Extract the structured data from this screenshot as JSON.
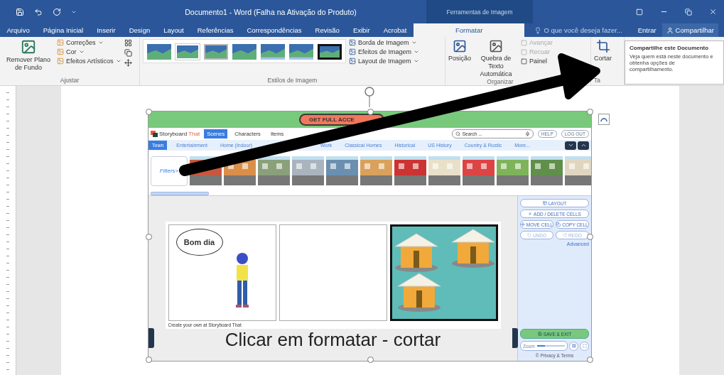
{
  "title_bar": {
    "title": "Documento1 - Word (Falha na Ativação do Produto)",
    "context_label": "Ferramentas de Imagem"
  },
  "tabs": [
    {
      "label": "Arquivo",
      "selected": false
    },
    {
      "label": "Página Inicial",
      "selected": false
    },
    {
      "label": "Inserir",
      "selected": false
    },
    {
      "label": "Design",
      "selected": false
    },
    {
      "label": "Layout",
      "selected": false
    },
    {
      "label": "Referências",
      "selected": false
    },
    {
      "label": "Correspondências",
      "selected": false
    },
    {
      "label": "Revisão",
      "selected": false
    },
    {
      "label": "Exibir",
      "selected": false
    },
    {
      "label": "Acrobat",
      "selected": false
    },
    {
      "label": "Formatar",
      "selected": true
    }
  ],
  "tell_me": {
    "placeholder": "O que você deseja fazer..."
  },
  "account": {
    "sign_in": "Entrar",
    "share": "Compartilhar"
  },
  "ribbon": {
    "adjust": {
      "label": "Ajustar",
      "remove_background": "Remover Plano de Fundo",
      "items": [
        "Correções",
        "Cor",
        "Efeitos Artísticos"
      ]
    },
    "styles": {
      "label": "Estilos de Imagem",
      "thumbnails": [
        {
          "kind": "plain",
          "selected": false
        },
        {
          "kind": "frame",
          "selected": false
        },
        {
          "kind": "shadow",
          "selected": false
        },
        {
          "kind": "plain",
          "selected": false
        },
        {
          "kind": "reflection",
          "selected": false
        },
        {
          "kind": "reflection",
          "selected": false
        },
        {
          "kind": "plain",
          "selected": true
        }
      ],
      "items": [
        "Borda de Imagem",
        "Efeitos de Imagem",
        "Layout de Imagem"
      ]
    },
    "arrange": {
      "label": "Organizar",
      "position": "Posição",
      "wrap": "Quebra de Texto Automática",
      "items": [
        {
          "label": "Avançar",
          "disabled": true
        },
        {
          "label": "Recuar",
          "disabled": true
        },
        {
          "label": "Painel",
          "disabled": false
        }
      ]
    },
    "size": {
      "label": "Ta",
      "crop": "Cortar"
    }
  },
  "tooltip": {
    "title": "Compartilhe este Documento",
    "text": "Veja quem está neste documento e obtenha opções de compartilhamento."
  },
  "storyboard": {
    "banner": "GET FULL ACCE",
    "logo_primary": "Storyboard",
    "logo_accent": "That",
    "nav": [
      {
        "label": "Scenes",
        "selected": true
      },
      {
        "label": "Characters",
        "selected": false
      },
      {
        "label": "Items",
        "selected": false
      }
    ],
    "search": {
      "placeholder": "Search ..."
    },
    "help": "HELP",
    "logout": "LOG OUT",
    "categories": [
      {
        "label": "Town",
        "selected": true
      },
      {
        "label": "Entertainment",
        "selected": false
      },
      {
        "label": "Home (Indoor)",
        "selected": false
      }
    ],
    "categories_after_arrow": [
      {
        "label": "Work",
        "selected": false
      },
      {
        "label": "Classical Homes",
        "selected": false
      },
      {
        "label": "Historical",
        "selected": false
      },
      {
        "label": "US History",
        "selected": false
      },
      {
        "label": "Country & Rustic",
        "selected": false
      },
      {
        "label": "More...",
        "selected": false
      }
    ],
    "filters": "Filters>",
    "panel": [
      {
        "label": "LAYOUT",
        "kind": "wide",
        "disabled": false
      },
      {
        "label": "ADD / DELETE CELLS",
        "kind": "wide",
        "disabled": false
      },
      {
        "label": "MOVE CELL",
        "kind": "half",
        "disabled": false
      },
      {
        "label": "COPY CELL",
        "kind": "half",
        "disabled": false
      },
      {
        "label": "UNDO",
        "kind": "half",
        "disabled": true
      },
      {
        "label": "REDO",
        "kind": "half",
        "disabled": true
      }
    ],
    "advanced": "Advanced",
    "save": "SAVE & EXIT",
    "zoom": {
      "label": "Zoom",
      "level": 0.3
    },
    "privacy": "© Privacy & Terms",
    "cells": [
      {
        "kind": "dialogue",
        "bubble": "Bom dia",
        "selected": false
      },
      {
        "kind": "empty",
        "selected": false
      },
      {
        "kind": "huts",
        "selected": true
      }
    ],
    "credit": "Create your own at Storyboard That"
  },
  "caption": "Clicar em formatar - cortar"
}
